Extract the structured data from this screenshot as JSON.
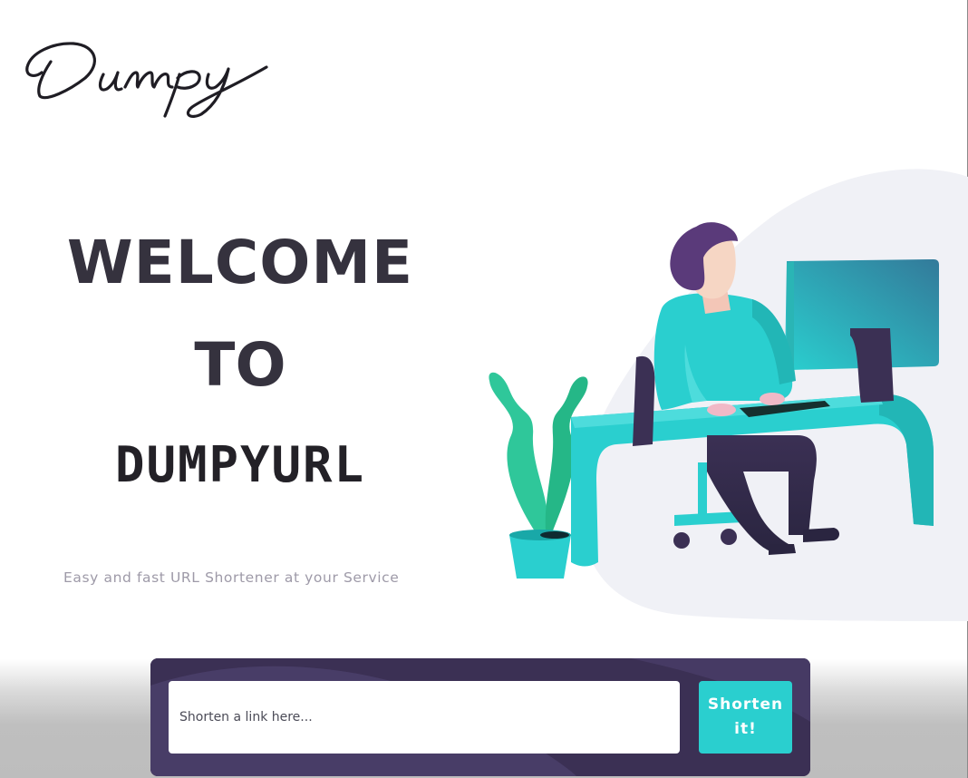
{
  "brand": {
    "logo_text": "Dumpy"
  },
  "hero": {
    "line1": "WELCOME",
    "line2": "TO",
    "line3": "DUMPYURL",
    "tagline": "Easy and fast URL Shortener at your Service"
  },
  "shortener": {
    "input_placeholder": "Shorten a link here...",
    "input_value": "",
    "button_label": "Shorten it!"
  },
  "icons": {
    "illustration": "person-at-desk-illustration"
  },
  "colors": {
    "accent": "#2acfcf",
    "panel": "#3b3054",
    "heading": "#35323e",
    "tagline": "#9e9aa8"
  }
}
